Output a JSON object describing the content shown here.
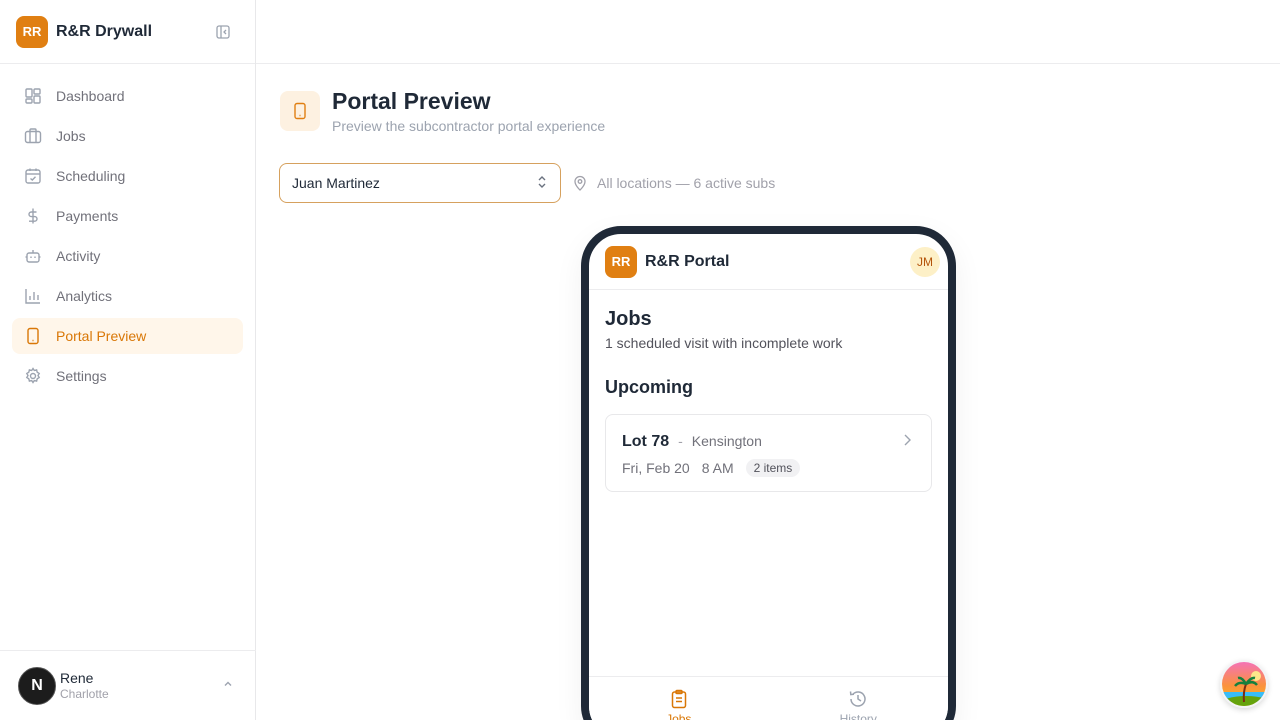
{
  "brand": {
    "logo_text": "RR",
    "name": "R&R Drywall"
  },
  "nav": {
    "items": [
      {
        "label": "Dashboard",
        "icon": "layout-grid-icon"
      },
      {
        "label": "Jobs",
        "icon": "briefcase-icon"
      },
      {
        "label": "Scheduling",
        "icon": "calendar-check-icon"
      },
      {
        "label": "Payments",
        "icon": "dollar-icon"
      },
      {
        "label": "Activity",
        "icon": "bot-icon"
      },
      {
        "label": "Analytics",
        "icon": "bar-chart-icon"
      },
      {
        "label": "Portal Preview",
        "icon": "tablet-icon",
        "active": true
      },
      {
        "label": "Settings",
        "icon": "gear-icon"
      }
    ]
  },
  "user": {
    "initial": "N",
    "name": "Rene",
    "location": "Charlotte"
  },
  "page": {
    "title": "Portal Preview",
    "subtitle": "Preview the subcontractor portal experience"
  },
  "controls": {
    "selected_sub": "Juan Martinez",
    "location_info": "All locations — 6 active subs"
  },
  "portal": {
    "logo_text": "RR",
    "title": "R&R Portal",
    "avatar": "JM",
    "heading": "Jobs",
    "summary": "1 scheduled visit with incomplete work",
    "section": "Upcoming",
    "job": {
      "lot": "Lot 78",
      "separator": "-",
      "place": "Kensington",
      "date": "Fri, Feb 20",
      "time": "8 AM",
      "items": "2 items"
    },
    "tabs": [
      {
        "label": "Jobs",
        "active": true
      },
      {
        "label": "History",
        "active": false
      }
    ]
  },
  "colors": {
    "accent": "#e07f12",
    "phone_frame": "#1f2937"
  }
}
